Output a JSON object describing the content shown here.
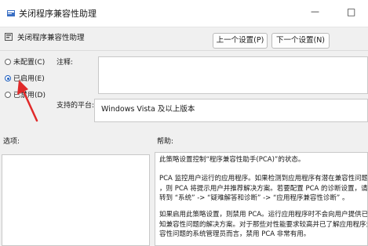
{
  "window": {
    "title": "关闭程序兼容性助理",
    "minimize_glyph": "—",
    "maximize_glyph": "□"
  },
  "header": {
    "setting_name": "关闭程序兼容性助理",
    "prev_button": "上一个设置(P)",
    "next_button": "下一个设置(N)"
  },
  "options": {
    "not_configured": "未配置(C)",
    "enabled": "已启用(E)",
    "disabled": "已禁用(D)",
    "selected": "enabled"
  },
  "comment": {
    "label": "注释:",
    "value": ""
  },
  "platform": {
    "label": "支持的平台:",
    "value": "Windows Vista 及以上版本"
  },
  "options_section": {
    "label": "选项:"
  },
  "help_section": {
    "label": "帮助:",
    "paragraphs": [
      "此策略设置控制“程序兼容性助手(PCA)”的状态。",
      "PCA 监控用户运行的应用程序。如果检测到应用程序有潜在兼容性问题\n，则 PCA 将提示用户并推荐解决方案。若要配置 PCA 的诊断设置，请\n转到 “系统” -> “疑难解答和诊断” -> “应用程序兼容性诊断” 。",
      "如果启用此策略设置，则禁用 PCA。运行应用程序时不会向用户提供已\n知兼容性问题的解决方案。对于那些对性能要求较高并已了解应用程序兼\n容性问题的系统管理员而言，禁用 PCA 非常有用。"
    ]
  },
  "colors": {
    "annotation_arrow": "#e02a2a",
    "radio_selected": "#1f5fbf"
  }
}
